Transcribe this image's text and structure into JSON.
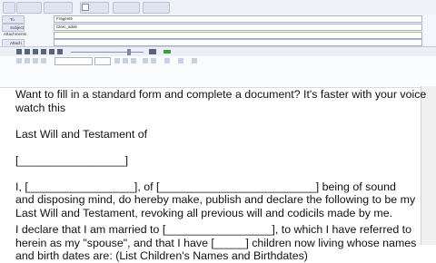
{
  "header": {
    "to_label": "To",
    "to_value": "Fragente",
    "subject_label": "Subject",
    "subject_value": "Clarc_adde",
    "attachments_label": "Attachments",
    "attach_label": "Attach"
  },
  "document": {
    "line1": "Want to fill in a standard form and complete a document? It's faster with your voice",
    "line2": "watch this",
    "title": "Last Will and Testament of",
    "blank_line": "[_________________]",
    "p1_line1": "I, [_________________], of [_________________________] being of sound",
    "p1_line2": "and disposing mind, do hereby make, publish and declare the following to be my",
    "p1_line3": "Last Will and Testament, revoking all previous will and codicils made by me.",
    "p2_line1": "I declare that I am married to [_________________], to which I have referred to",
    "p2_line2": "herein as my \"spouse\", and that I have [_____] children now living whose names",
    "p2_line3": "and birth dates are: (List Children's Names and Birthdates)"
  },
  "colors": {
    "accent": "#2f74c9",
    "toolbar": "#eef1f7"
  }
}
